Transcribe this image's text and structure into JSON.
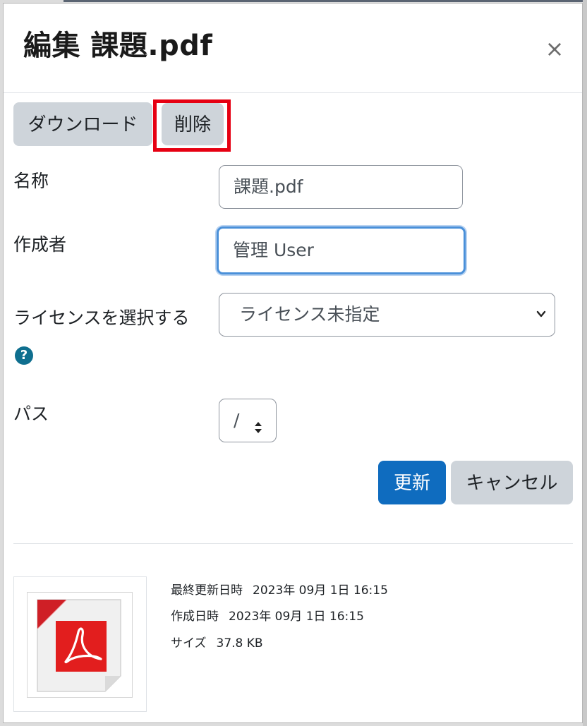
{
  "dialog": {
    "title": "編集 課題.pdf",
    "close_glyph": "×"
  },
  "toolbar": {
    "download_label": "ダウンロード",
    "delete_label": "削除"
  },
  "form": {
    "name_label": "名称",
    "name_value": "課題.pdf",
    "author_label": "作成者",
    "author_value": "管理 User",
    "license_label": "ライセンスを選択する",
    "license_value": "ライセンス未指定",
    "help_glyph": "?",
    "path_label": "パス",
    "path_value": "/"
  },
  "actions": {
    "update_label": "更新",
    "cancel_label": "キャンセル"
  },
  "file_info": {
    "modified_label": "最終更新日時",
    "modified_value": "2023年 09月 1日 16:15",
    "created_label": "作成日時",
    "created_value": "2023年 09月 1日 16:15",
    "size_label": "サイズ",
    "size_value": "37.8 KB",
    "thumbnail_icon": "pdf-file-icon"
  },
  "colors": {
    "primary": "#0f6cbf",
    "secondary": "#ced4da",
    "highlight": "#e60012",
    "focus_ring": "#4a90d9",
    "help_icon": "#0f6f8f",
    "pdf_red": "#e21e1e"
  }
}
